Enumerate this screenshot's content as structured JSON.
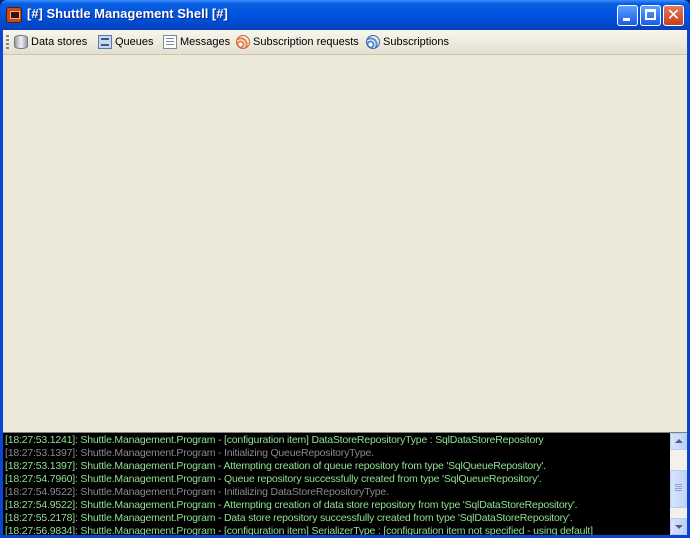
{
  "window": {
    "title": "[#] Shuttle Management Shell [#]",
    "controls": {
      "minimize": "minimize-icon",
      "maximize": "maximize-icon",
      "close": "close-icon"
    }
  },
  "toolbar": {
    "items": [
      {
        "label": "Data stores",
        "icon": "database-icon"
      },
      {
        "label": "Queues",
        "icon": "queue-icon"
      },
      {
        "label": "Messages",
        "icon": "messages-icon"
      },
      {
        "label": "Subscription requests",
        "icon": "subscription-request-icon"
      },
      {
        "label": "Subscriptions",
        "icon": "subscription-icon"
      }
    ]
  },
  "log": {
    "lines": [
      {
        "level": "info",
        "text": "[18:27:53.1241]: Shuttle.Management.Program - [configuration item] DataStoreRepositoryType : SqlDataStoreRepository"
      },
      {
        "level": "debug",
        "text": "[18:27:53.1397]: Shuttle.Management.Program - Initializing QueueRepositoryType."
      },
      {
        "level": "info",
        "text": "[18:27:53.1397]: Shuttle.Management.Program - Attempting creation of queue repository from type 'SqlQueueRepository'."
      },
      {
        "level": "info",
        "text": "[18:27:54.7960]: Shuttle.Management.Program - Queue repository successfully created from type 'SqlQueueRepository'."
      },
      {
        "level": "debug",
        "text": "[18:27:54.9522]: Shuttle.Management.Program - Initializing DataStoreRepositoryType."
      },
      {
        "level": "info",
        "text": "[18:27:54.9522]: Shuttle.Management.Program - Attempting creation of data store repository from type 'SqlDataStoreRepository'."
      },
      {
        "level": "info",
        "text": "[18:27:55.2178]: Shuttle.Management.Program - Data store repository successfully created from type 'SqlDataStoreRepository'."
      },
      {
        "level": "info",
        "text": "[18:27:56.9834]: Shuttle.Management.Program - [configuration item] SerializerType : [configuration item not specified - using default]"
      }
    ]
  },
  "colors": {
    "title_bar": "#0054e3",
    "log_background": "#000000",
    "log_info": "#8fe08f",
    "log_debug": "#8a8a8a",
    "workspace": "#ece9d8"
  }
}
